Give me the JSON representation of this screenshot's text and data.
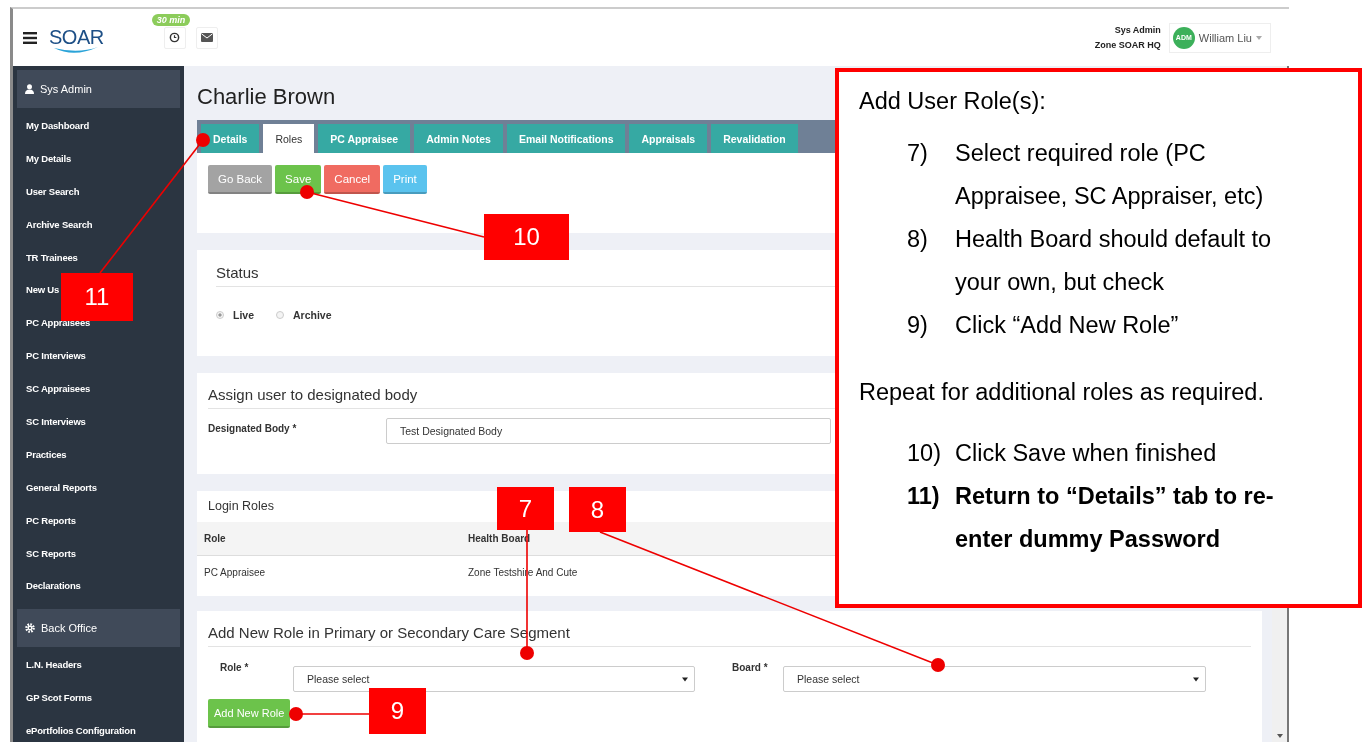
{
  "header": {
    "logo": "SOAR",
    "timer_badge": "30 min",
    "user_role": "Sys Admin",
    "user_zone": "Zone SOAR HQ",
    "avatar_initials": "ADM",
    "user_name": "William Liu"
  },
  "sidebar": {
    "sections": [
      {
        "title": "Sys Admin",
        "kind": "user",
        "items": [
          "My Dashboard",
          "My Details",
          "User Search",
          "Archive Search",
          "TR Trainees",
          "New Us",
          "PC Appraisees",
          "PC Interviews",
          "SC Appraisees",
          "SC Interviews",
          "Practices",
          "General Reports",
          "PC Reports",
          "SC Reports",
          "Declarations"
        ]
      },
      {
        "title": "Back Office",
        "kind": "gear",
        "items": [
          "L.N. Headers",
          "GP Scot Forms",
          "ePortfolios Configuration"
        ]
      }
    ]
  },
  "page_title": "Charlie Brown",
  "tabs": [
    {
      "label": "Details",
      "selected": false
    },
    {
      "label": "Roles",
      "selected": true
    },
    {
      "label": "PC Appraisee",
      "selected": false
    },
    {
      "label": "Admin Notes",
      "selected": false
    },
    {
      "label": "Email Notifications",
      "selected": false
    },
    {
      "label": "Appraisals",
      "selected": false
    },
    {
      "label": "Revalidation",
      "selected": false
    }
  ],
  "buttons": [
    {
      "label": "Go Back",
      "kind": "default"
    },
    {
      "label": "Save",
      "kind": "success"
    },
    {
      "label": "Cancel",
      "kind": "danger"
    },
    {
      "label": "Print",
      "kind": "info"
    }
  ],
  "status": {
    "title": "Status",
    "options": [
      {
        "label": "Live",
        "selected": true
      },
      {
        "label": "Archive",
        "selected": false
      }
    ]
  },
  "designated_body": {
    "title": "Assign user to designated body",
    "label": "Designated Body *",
    "value": "Test Designated Body"
  },
  "login_roles": {
    "title": "Login Roles",
    "columns": [
      "Role",
      "Health Board"
    ],
    "rows": [
      [
        "PC Appraisee",
        "Zone Testshire And Cute"
      ]
    ]
  },
  "add_role": {
    "title": "Add New Role in Primary or Secondary Care Segment",
    "fields": [
      {
        "label": "Role *",
        "value": "Please select"
      },
      {
        "label": "Board *",
        "value": "Please select"
      }
    ],
    "button": "Add New Role"
  },
  "callout": {
    "title": "Add User Role(s):",
    "steps": [
      {
        "number": "7)",
        "text": "Select required role (PC Appraisee, SC Appraiser, etc)",
        "bold": false
      },
      {
        "number": "8)",
        "text": "Health Board should default to your own, but check",
        "bold": false
      },
      {
        "number": "9)",
        "text": "Click “Add New Role”",
        "bold": false
      }
    ],
    "note": "Repeat for additional roles as required.",
    "steps_after": [
      {
        "number": "10)",
        "text": "Click Save when finished",
        "bold": false
      },
      {
        "number": "11)",
        "text": "Return to “Details” tab to re-enter dummy Password",
        "bold": true
      }
    ]
  },
  "markers": [
    "11",
    "10",
    "7",
    "8",
    "9"
  ]
}
